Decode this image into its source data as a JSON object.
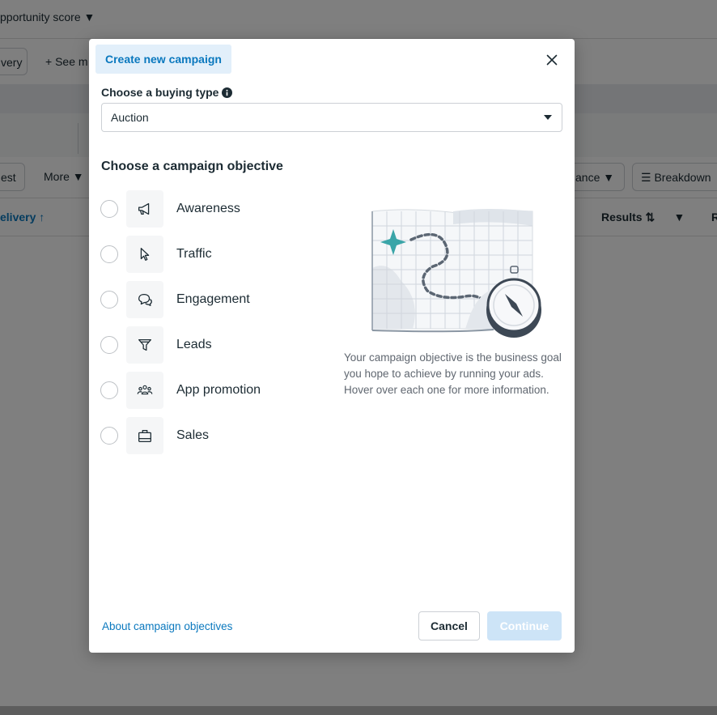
{
  "background": {
    "opportunity_score": "pportunity score",
    "delivery_pill": "very",
    "see_more": "See m",
    "test_button": "est",
    "more_button": "More",
    "performance_button": "ance",
    "breakdown_button": "Breakdown",
    "delivery_column": "elivery",
    "results_column": "Results",
    "last_column": "R"
  },
  "modal": {
    "title": "Create new campaign",
    "buying_type_label": "Choose a buying type",
    "buying_type_value": "Auction",
    "objective_title": "Choose a campaign objective",
    "objectives": [
      {
        "label": "Awareness",
        "icon": "megaphone-icon"
      },
      {
        "label": "Traffic",
        "icon": "cursor-icon"
      },
      {
        "label": "Engagement",
        "icon": "chat-bubbles-icon"
      },
      {
        "label": "Leads",
        "icon": "funnel-icon"
      },
      {
        "label": "App promotion",
        "icon": "people-icon"
      },
      {
        "label": "Sales",
        "icon": "shopping-bag-icon"
      }
    ],
    "description": "Your campaign objective is the business goal you hope to achieve by running your ads. Hover over each one for more information.",
    "about_link": "About campaign objectives",
    "cancel_label": "Cancel",
    "continue_label": "Continue"
  },
  "colors": {
    "accent": "#0a78be",
    "title_bg": "#e2effa",
    "continue_disabled_bg": "#cde4f7",
    "teal_star": "#3aa5a8"
  }
}
